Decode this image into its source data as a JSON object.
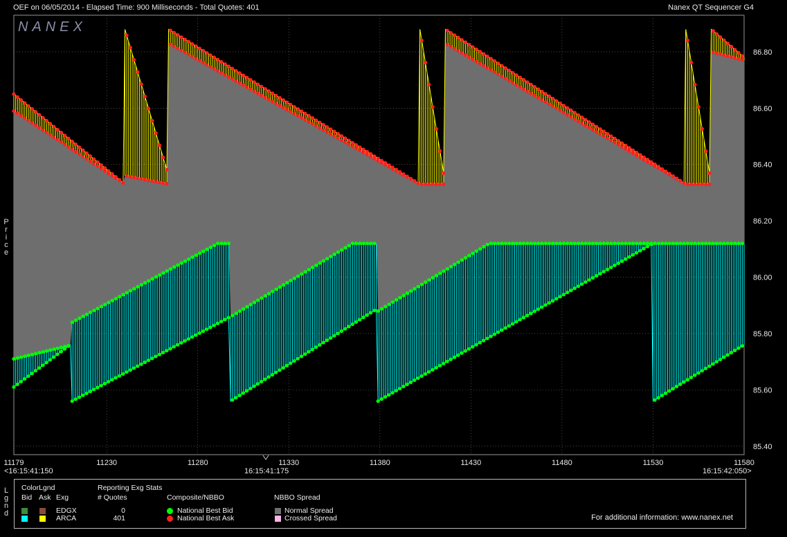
{
  "header": {
    "left": "OEF on 06/05/2014  -  Elapsed Time: 900 Milliseconds  -  Total Quotes: 401",
    "right": "Nanex QT Sequencer G4",
    "watermark": "NANEX"
  },
  "y_axis_label": "Price",
  "legend_side_label": "Lgnd",
  "legend": {
    "color_legend_title": "ColorLgnd",
    "col_bid": "Bid",
    "col_ask": "Ask",
    "col_exg": "Exg",
    "stats_title": "Reporting Exg Stats",
    "stats_col": "# Quotes",
    "exchanges": [
      {
        "name": "EDGX",
        "quotes": "0",
        "bid_color": "#3c8c3c",
        "ask_color": "#8c4a3c"
      },
      {
        "name": "ARCA",
        "quotes": "401",
        "bid_color": "#00ffff",
        "ask_color": "#ffff00"
      }
    ],
    "composite_title": "Composite/NBBO",
    "nbb_label": "National Best Bid",
    "nbo_label": "National Best Ask",
    "nbb_color": "#00ff00",
    "nbo_color": "#ff2020",
    "spread_title": "NBBO Spread",
    "normal_spread": "Normal Spread",
    "crossed_spread": "Crossed Spread",
    "normal_spread_color": "#6e6e6e",
    "crossed_spread_color": "#ffb4e6",
    "info": "For additional information: www.nanex.net"
  },
  "time_labels": {
    "left": "<16:15:41:150",
    "mid": "16:15:41:175",
    "right": "16:15:42:050>"
  },
  "chart_data": {
    "type": "line",
    "xlabel": "",
    "ylabel": "Price",
    "xlim": [
      11179,
      11580
    ],
    "ylim": [
      85.37,
      86.93
    ],
    "xticks": [
      "11179",
      "11230",
      "11280",
      "11330",
      "11380",
      "11430",
      "11480",
      "11530",
      "11580"
    ],
    "yticks": [
      "85.40",
      "85.60",
      "85.80",
      "86.00",
      "86.20",
      "86.40",
      "86.60",
      "86.80"
    ],
    "bid_cycles": [
      {
        "x0": 11179,
        "x1": 11210,
        "y0": 85.61,
        "y1": 85.76
      },
      {
        "x0": 11211,
        "x1": 11298,
        "y0": 85.56,
        "y1": 85.86
      },
      {
        "x0": 11298,
        "x1": 11379,
        "y0": 85.56,
        "y1": 85.89
      },
      {
        "x0": 11379,
        "x1": 11530,
        "y0": 85.56,
        "y1": 86.12
      },
      {
        "x0": 11530,
        "x1": 11580,
        "y0": 85.56,
        "y1": 85.76
      }
    ],
    "nbb_cycles": [
      {
        "x0": 11179,
        "x1": 11211,
        "y0": 85.71,
        "y1": 85.76
      },
      {
        "x0": 11211,
        "x1": 11291,
        "y0": 85.84,
        "y1": 86.12
      },
      {
        "x0": 11291,
        "x1": 11298,
        "y0": 86.12,
        "y1": 86.12
      },
      {
        "x0": 11298,
        "x1": 11365,
        "y0": 85.86,
        "y1": 86.12
      },
      {
        "x0": 11365,
        "x1": 11379,
        "y0": 86.12,
        "y1": 86.12
      },
      {
        "x0": 11379,
        "x1": 11440,
        "y0": 85.88,
        "y1": 86.12
      },
      {
        "x0": 11440,
        "x1": 11580,
        "y0": 86.12,
        "y1": 86.12
      }
    ],
    "ask_cycles": [
      {
        "x0": 11179,
        "x1": 11240,
        "y0": 86.65,
        "y1": 86.33
      },
      {
        "x0": 11240,
        "x1": 11264,
        "y0": 86.88,
        "y1": 86.36
      },
      {
        "x0": 11264,
        "x1": 11402,
        "y0": 86.88,
        "y1": 86.33
      },
      {
        "x0": 11402,
        "x1": 11416,
        "y0": 86.88,
        "y1": 86.33
      },
      {
        "x0": 11416,
        "x1": 11548,
        "y0": 86.88,
        "y1": 86.33
      },
      {
        "x0": 11548,
        "x1": 11562,
        "y0": 86.88,
        "y1": 86.33
      },
      {
        "x0": 11562,
        "x1": 11580,
        "y0": 86.88,
        "y1": 86.78
      }
    ],
    "nbo_cycles": [
      {
        "x0": 11179,
        "x1": 11240,
        "y0": 86.59,
        "y1": 86.33
      },
      {
        "x0": 11240,
        "x1": 11264,
        "y0": 86.36,
        "y1": 86.33
      },
      {
        "x0": 11264,
        "x1": 11402,
        "y0": 86.83,
        "y1": 86.33
      },
      {
        "x0": 11402,
        "x1": 11416,
        "y0": 86.33,
        "y1": 86.33
      },
      {
        "x0": 11416,
        "x1": 11548,
        "y0": 86.83,
        "y1": 86.33
      },
      {
        "x0": 11548,
        "x1": 11562,
        "y0": 86.33,
        "y1": 86.33
      },
      {
        "x0": 11562,
        "x1": 11580,
        "y0": 86.8,
        "y1": 86.77
      }
    ],
    "spread_color": "#6e6e6e",
    "bid_color": "#00ffff",
    "ask_color": "#ffff00",
    "nbb_color": "#00ff00",
    "nbo_color": "#ff2020"
  }
}
